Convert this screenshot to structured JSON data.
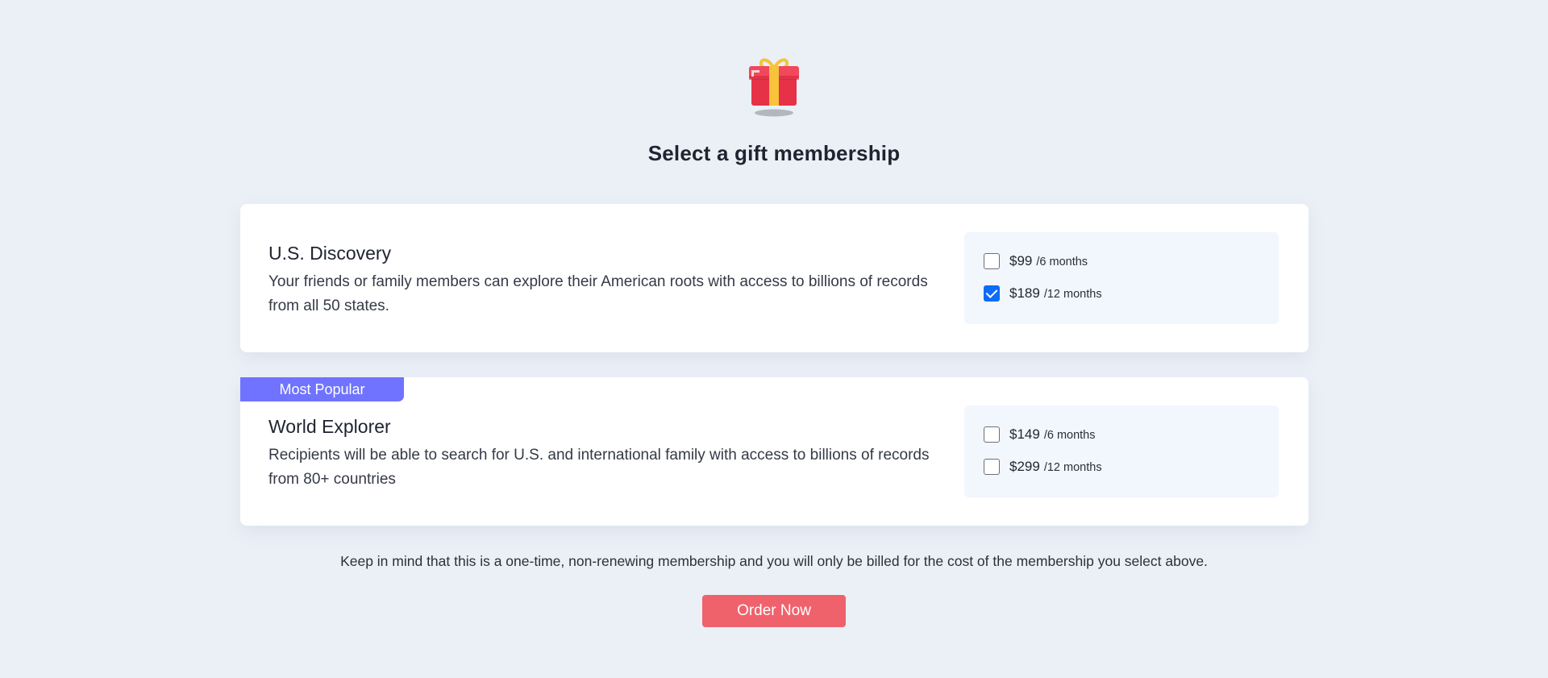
{
  "header": {
    "icon": "gift-icon",
    "title": "Select a gift membership"
  },
  "plans": [
    {
      "badge": "",
      "name": "U.S. Discovery",
      "description": "Your friends or family members can explore their American roots with access to billions of records from all 50 states.",
      "options": [
        {
          "price": "$99",
          "term": "/6 months",
          "checked": false
        },
        {
          "price": "$189",
          "term": "/12 months",
          "checked": true
        }
      ]
    },
    {
      "badge": "Most Popular",
      "name": "World Explorer",
      "description": "Recipients will be able to search for U.S. and international family with access to billions of records from 80+ countries",
      "options": [
        {
          "price": "$149",
          "term": "/6 months",
          "checked": false
        },
        {
          "price": "$299",
          "term": "/12 months",
          "checked": false
        }
      ]
    }
  ],
  "note": "Keep in mind that this is a one-time, non-renewing membership and you will only be billed for the cost of the membership you select above.",
  "order_button": "Order Now",
  "colors": {
    "background": "#ebf0f7",
    "badge": "#6f73ff",
    "checkbox_checked": "#0b6cf7",
    "order_button": "#ef626c"
  }
}
